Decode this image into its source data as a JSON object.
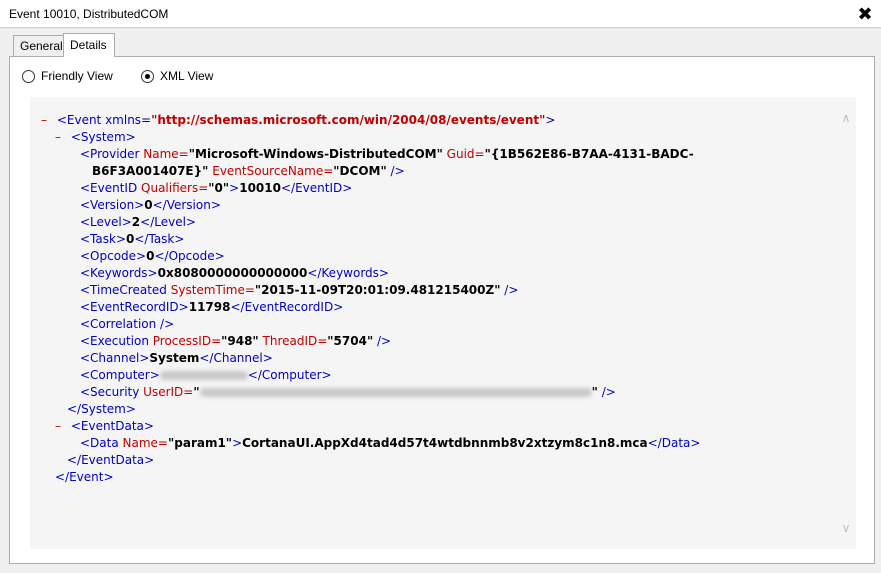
{
  "window": {
    "title": "Event 10010, DistributedCOM",
    "close_label": "✖"
  },
  "tabs": [
    {
      "label": "General"
    },
    {
      "label": "Details"
    }
  ],
  "view_options": {
    "friendly": "Friendly View",
    "xml": "XML View"
  },
  "xml": {
    "event_open": "<Event xmlns=",
    "event_ns": "\"http://schemas.microsoft.com/win/2004/08/events/event\"",
    "event_close_bracket": ">",
    "system_open": "<System>",
    "provider_tag": "<Provider ",
    "provider_name_attr": "Name=",
    "provider_name_val": "\"Microsoft-Windows-DistributedCOM\"",
    "guid_attr": " Guid=",
    "guid_val_1": "\"{1B562E86-B7AA-4131-BADC-",
    "guid_val_2": "B6F3A001407E}\"",
    "event_source_attr": " EventSourceName=",
    "event_source_val": "\"DCOM\"",
    "self_close": " />",
    "eventid_open": "<EventID ",
    "qualifiers_attr": "Qualifiers=",
    "qualifiers_val": "\"0\"",
    "gt": ">",
    "eventid_val": "10010",
    "eventid_close": "</EventID>",
    "version_open": "<Version>",
    "version_val": "0",
    "version_close": "</Version>",
    "level_open": "<Level>",
    "level_val": "2",
    "level_close": "</Level>",
    "task_open": "<Task>",
    "task_val": "0",
    "task_close": "</Task>",
    "opcode_open": "<Opcode>",
    "opcode_val": "0",
    "opcode_close": "</Opcode>",
    "keywords_open": "<Keywords>",
    "keywords_val": "0x8080000000000000",
    "keywords_close": "</Keywords>",
    "timecreated_tag": "<TimeCreated ",
    "systemtime_attr": "SystemTime=",
    "systemtime_val": "\"2015-11-09T20:01:09.481215400Z\"",
    "recordid_open": "<EventRecordID>",
    "recordid_val": "11798",
    "recordid_close": "</EventRecordID>",
    "correlation": "<Correlation />",
    "execution_tag": "<Execution ",
    "processid_attr": "ProcessID=",
    "processid_val": "\"948\"",
    "threadid_attr": " ThreadID=",
    "threadid_val": "\"5704\"",
    "channel_open": "<Channel>",
    "channel_val": "System",
    "channel_close": "</Channel>",
    "computer_open": "<Computer>",
    "computer_close": "</Computer>",
    "security_tag": "<Security ",
    "userid_attr": "UserID=",
    "userid_quote_open": "\"",
    "userid_quote_close": "\"",
    "system_close": "</System>",
    "eventdata_open": "<EventData>",
    "data_tag": "<Data ",
    "data_name_attr": "Name=",
    "data_name_val": "\"param1\"",
    "data_val": "CortanaUI.AppXd4tad4d57t4wtdbnnmb8v2xtzym8c1n8.mca",
    "data_close": "</Data>",
    "eventdata_close": "</EventData>",
    "event_close": "</Event>",
    "toggle": "–"
  },
  "colors": {
    "tag": "#0000c0",
    "attribute": "#c00000",
    "value": "#000000"
  }
}
